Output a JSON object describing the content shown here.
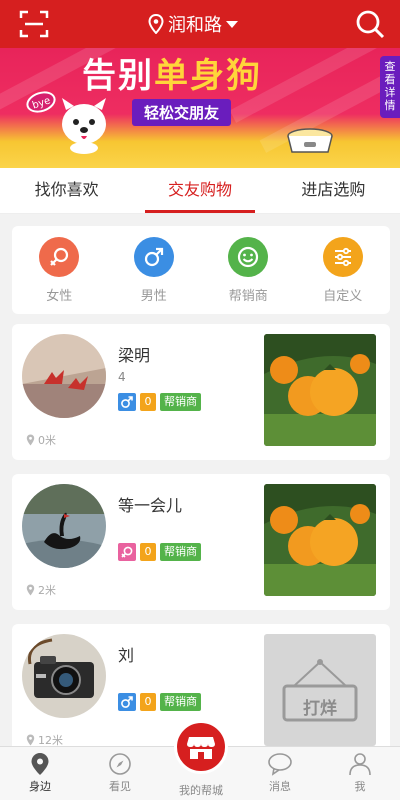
{
  "header": {
    "location": "润和路"
  },
  "banner": {
    "title_part1": "告别",
    "title_part2": "单身狗",
    "subtitle": "轻松交朋友",
    "bye_text": "bye",
    "side_button": "查看详情"
  },
  "tabs": [
    {
      "label": "找你喜欢",
      "active": false
    },
    {
      "label": "交友购物",
      "active": true
    },
    {
      "label": "进店选购",
      "active": false
    }
  ],
  "categories": [
    {
      "label": "女性",
      "icon": "female-icon",
      "color": "#ef6a4b"
    },
    {
      "label": "男性",
      "icon": "male-icon",
      "color": "#3b8ee3"
    },
    {
      "label": "帮销商",
      "icon": "smiley-icon",
      "color": "#54b34a"
    },
    {
      "label": "自定义",
      "icon": "sliders-icon",
      "color": "#f3a41b"
    }
  ],
  "users": [
    {
      "name": "梁明",
      "count": "4",
      "gender": "male",
      "gender_color": "#3b8ee3",
      "num_badge": "0",
      "shop_badge": "帮销商",
      "distance": "0米",
      "photo": "oranges"
    },
    {
      "name": "等一会儿",
      "count": "",
      "gender": "female",
      "gender_color": "#e9629f",
      "num_badge": "0",
      "shop_badge": "帮销商",
      "distance": "2米",
      "photo": "oranges"
    },
    {
      "name": "刘",
      "count": "",
      "gender": "male",
      "gender_color": "#3b8ee3",
      "num_badge": "0",
      "shop_badge": "帮销商",
      "distance": "12米",
      "photo": "closed",
      "closed_text": "打烊"
    }
  ],
  "bottom_nav": [
    {
      "label": "身边",
      "icon": "location-pin-icon",
      "active": true
    },
    {
      "label": "看见",
      "icon": "compass-icon",
      "active": false
    },
    {
      "label": "我的帮城",
      "icon": "store-icon",
      "active": false
    },
    {
      "label": "消息",
      "icon": "message-icon",
      "active": false
    },
    {
      "label": "我",
      "icon": "person-icon",
      "active": false
    }
  ]
}
